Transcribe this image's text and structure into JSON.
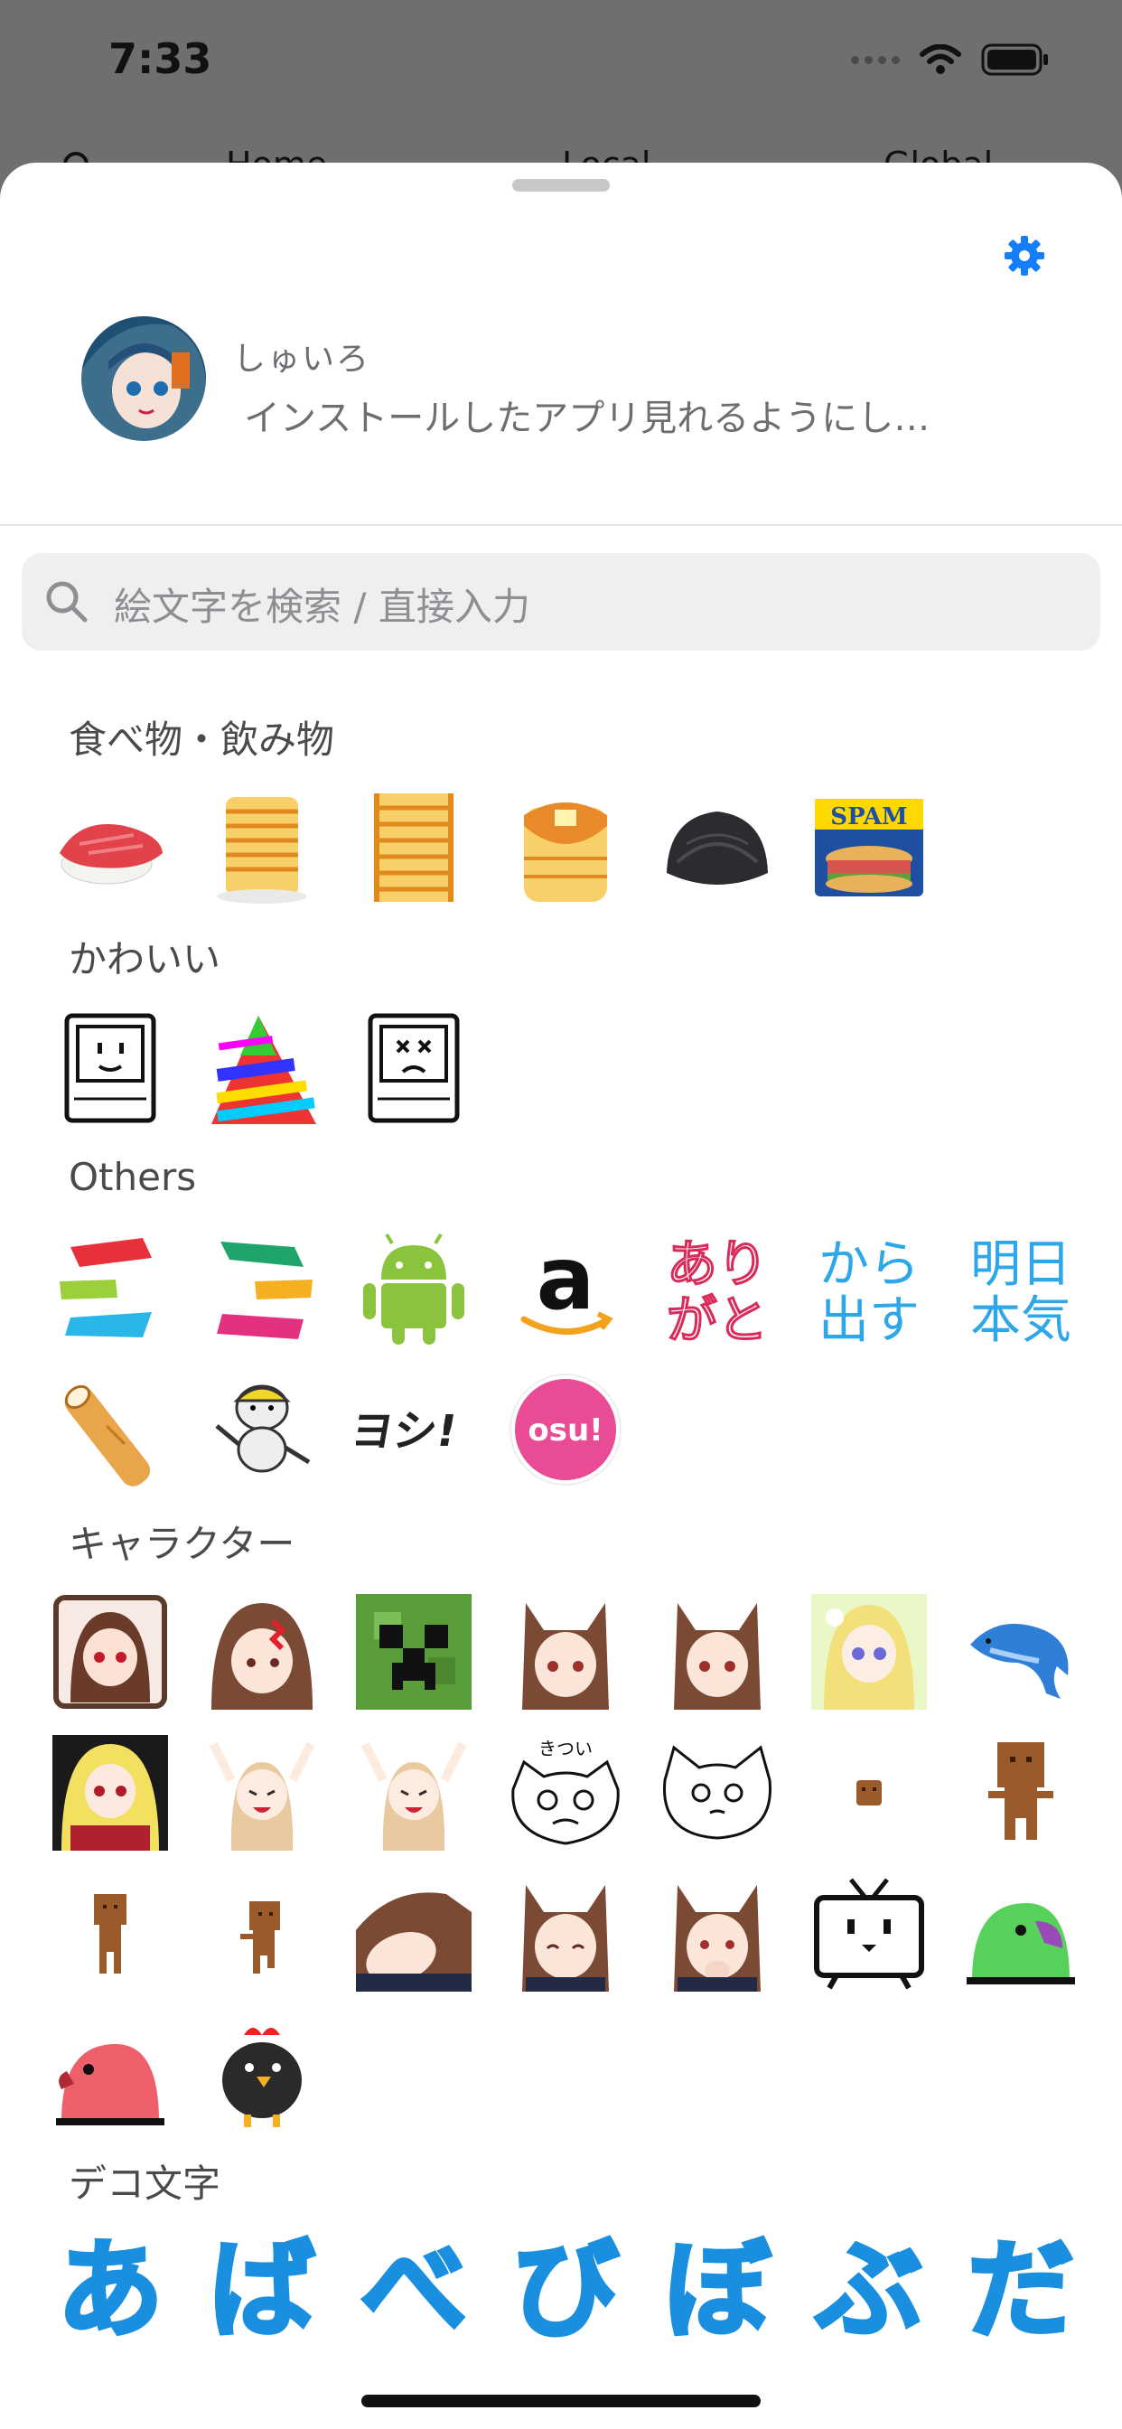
{
  "status_bar": {
    "time": "7:33"
  },
  "background_nav": {
    "home": "Home",
    "local": "Local",
    "global": "Global"
  },
  "profile": {
    "username": "しゅいろ",
    "status": "インストールしたアプリ見れるようにし…"
  },
  "search": {
    "placeholder": "絵文字を検索 / 直接入力"
  },
  "sections": {
    "food": "食べ物・飲み物",
    "cute": "かわいい",
    "others": "Others",
    "characters": "キャラクター",
    "deco": "デコ文字"
  },
  "emoji_text": {
    "arigato_1": "あり",
    "arigato_2": "がと",
    "karadasu_1": "から",
    "karadasu_2": "出す",
    "ashita_1": "明日",
    "ashita_2": "本気",
    "yoshi": "ヨシ!",
    "osu": "osu!",
    "spam": "SPAM",
    "kitsui": "きつい"
  },
  "deco_chars": [
    "あ",
    "ば",
    "べ",
    "び",
    "ぼ",
    "ぶ",
    "だ"
  ],
  "colors": {
    "accent": "#147EFB",
    "sheet": "#FFFFFF",
    "dim": "#6F6F6F"
  },
  "icons": [
    "wifi-icon",
    "battery-icon",
    "gear-icon",
    "search-icon"
  ]
}
